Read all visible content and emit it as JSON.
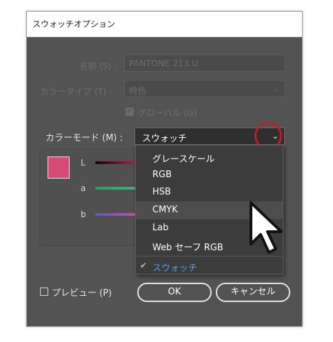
{
  "dialog": {
    "title": "スウォッチオプション",
    "name_label": "名前 (S) :",
    "name_value": "PANTONE 213 U",
    "color_type_label": "カラータイプ (T) :",
    "color_type_value": "特色",
    "global_label": "グローバル (G)",
    "global_checked": true,
    "color_mode_label": "カラーモード (M) :",
    "color_mode_value": "スウォッチ",
    "swatch_color": "#d84a76",
    "channels": [
      {
        "label": "L"
      },
      {
        "label": "a"
      },
      {
        "label": "b"
      }
    ],
    "preview_label": "プレビュー (P)",
    "preview_checked": false,
    "ok_label": "OK",
    "cancel_label": "キャンセル"
  },
  "dropdown": {
    "items": [
      {
        "label": "グレースケール"
      },
      {
        "label": "RGB"
      },
      {
        "label": "HSB"
      },
      {
        "label": "CMYK",
        "hovered": true
      },
      {
        "label": "Lab"
      },
      {
        "label": "Web セーフ RGB"
      }
    ],
    "selected_item": {
      "label": "スウォッチ",
      "checked": true
    }
  },
  "icons": {
    "chevron": "chevron-down-icon",
    "checkmark": "checkmark-icon",
    "cursor": "arrow-cursor-icon"
  },
  "colors": {
    "accent": "#49a2f5",
    "annotation": "#c41d24"
  }
}
